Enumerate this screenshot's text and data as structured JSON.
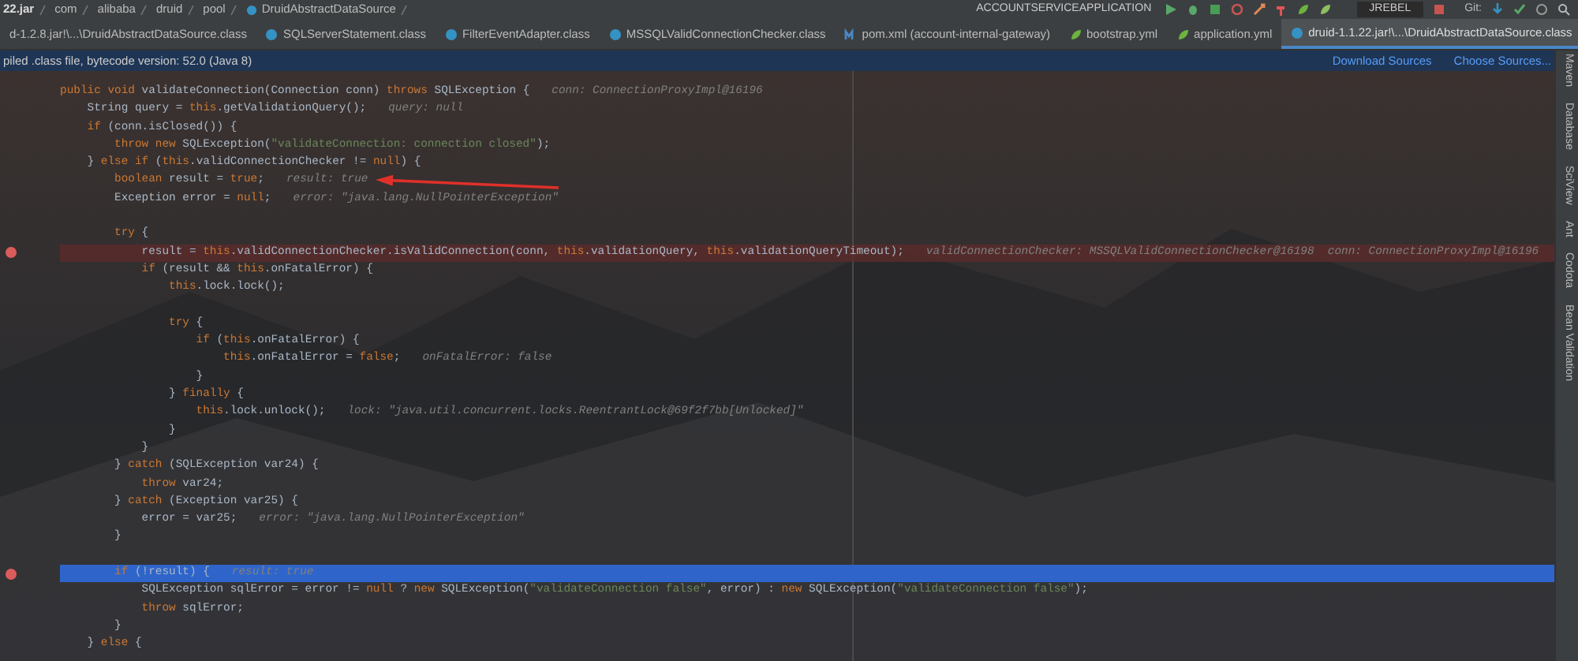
{
  "breadcrumbs": [
    "22.jar",
    "com",
    "alibaba",
    "druid",
    "pool",
    "DruidAbstractDataSource"
  ],
  "run_config": "ACCOUNTSERVICEAPPLICATION",
  "jrebel": "JREBEL",
  "vcs": "Git:",
  "tabs": [
    {
      "label": "d-1.2.8.jar!\\...\\DruidAbstractDataSource.class",
      "kind": "none",
      "selected": false
    },
    {
      "label": "SQLServerStatement.class",
      "kind": "class",
      "selected": false
    },
    {
      "label": "FilterEventAdapter.class",
      "kind": "class",
      "selected": false
    },
    {
      "label": "MSSQLValidConnectionChecker.class",
      "kind": "class",
      "selected": false
    },
    {
      "label": "pom.xml (account-internal-gateway)",
      "kind": "maven",
      "selected": false
    },
    {
      "label": "bootstrap.yml",
      "kind": "yaml",
      "selected": false
    },
    {
      "label": "application.yml",
      "kind": "yaml",
      "selected": false
    },
    {
      "label": "druid-1.1.22.jar!\\...\\DruidAbstractDataSource.class",
      "kind": "class",
      "selected": true
    }
  ],
  "info_bar": {
    "message": "piled .class file, bytecode version: 52.0 (Java 8)",
    "actions": [
      "Download Sources",
      "Choose Sources..."
    ]
  },
  "code": {
    "lines": [
      {
        "kind": "normal",
        "tokens": [
          {
            "kind": "kw",
            "text": "public void "
          },
          {
            "kind": "plain",
            "text": "validateConnection(Connection conn) "
          },
          {
            "kind": "kw",
            "text": "throws "
          },
          {
            "kind": "plain",
            "text": "SQLException {"
          }
        ],
        "hint": "conn: ConnectionProxyImpl@16196"
      },
      {
        "kind": "normal",
        "tokens": [
          {
            "kind": "plain",
            "text": "    String query = "
          },
          {
            "kind": "kw",
            "text": "this"
          },
          {
            "kind": "plain",
            "text": ".getValidationQuery();"
          }
        ],
        "hint": "query: null"
      },
      {
        "kind": "normal",
        "tokens": [
          {
            "kind": "kw",
            "text": "    if "
          },
          {
            "kind": "plain",
            "text": "(conn.isClosed()) {"
          }
        ]
      },
      {
        "kind": "normal",
        "tokens": [
          {
            "kind": "kw",
            "text": "        throw new "
          },
          {
            "kind": "plain",
            "text": "SQLException("
          },
          {
            "kind": "str",
            "text": "\"validateConnection: connection closed\""
          },
          {
            "kind": "plain",
            "text": ");"
          }
        ]
      },
      {
        "kind": "normal",
        "tokens": [
          {
            "kind": "plain",
            "text": "    } "
          },
          {
            "kind": "kw",
            "text": "else if "
          },
          {
            "kind": "plain",
            "text": "("
          },
          {
            "kind": "kw",
            "text": "this"
          },
          {
            "kind": "plain",
            "text": ".validConnectionChecker != "
          },
          {
            "kind": "kw",
            "text": "null"
          },
          {
            "kind": "plain",
            "text": ") {"
          }
        ]
      },
      {
        "kind": "normal",
        "tokens": [
          {
            "kind": "kw",
            "text": "        boolean "
          },
          {
            "kind": "plain",
            "text": "result = "
          },
          {
            "kind": "kw",
            "text": "true"
          },
          {
            "kind": "plain",
            "text": ";"
          }
        ],
        "hint": "result: true"
      },
      {
        "kind": "normal",
        "tokens": [
          {
            "kind": "plain",
            "text": "        Exception error = "
          },
          {
            "kind": "kw",
            "text": "null"
          },
          {
            "kind": "plain",
            "text": ";"
          }
        ],
        "hint": "error: \"java.lang.NullPointerException\""
      },
      {
        "kind": "blank"
      },
      {
        "kind": "normal",
        "tokens": [
          {
            "kind": "kw",
            "text": "        try "
          },
          {
            "kind": "plain",
            "text": "{"
          }
        ]
      },
      {
        "kind": "breakpoint",
        "tokens": [
          {
            "kind": "plain",
            "text": "            result = "
          },
          {
            "kind": "kw",
            "text": "this"
          },
          {
            "kind": "plain",
            "text": ".validConnectionChecker.isValidConnection(conn, "
          },
          {
            "kind": "kw",
            "text": "this"
          },
          {
            "kind": "plain",
            "text": ".validationQuery, "
          },
          {
            "kind": "kw",
            "text": "this"
          },
          {
            "kind": "plain",
            "text": ".validationQueryTimeout);"
          }
        ],
        "hint": "validConnectionChecker: MSSQLValidConnectionChecker@16198  conn: ConnectionProxyImpl@16196"
      },
      {
        "kind": "normal",
        "tokens": [
          {
            "kind": "kw",
            "text": "            if "
          },
          {
            "kind": "plain",
            "text": "(result && "
          },
          {
            "kind": "kw",
            "text": "this"
          },
          {
            "kind": "plain",
            "text": ".onFatalError) {"
          }
        ]
      },
      {
        "kind": "normal",
        "tokens": [
          {
            "kind": "kw",
            "text": "                this"
          },
          {
            "kind": "plain",
            "text": ".lock.lock();"
          }
        ]
      },
      {
        "kind": "blank"
      },
      {
        "kind": "normal",
        "tokens": [
          {
            "kind": "kw",
            "text": "                try "
          },
          {
            "kind": "plain",
            "text": "{"
          }
        ]
      },
      {
        "kind": "normal",
        "tokens": [
          {
            "kind": "kw",
            "text": "                    if "
          },
          {
            "kind": "plain",
            "text": "("
          },
          {
            "kind": "kw",
            "text": "this"
          },
          {
            "kind": "plain",
            "text": ".onFatalError) {"
          }
        ]
      },
      {
        "kind": "normal",
        "tokens": [
          {
            "kind": "kw",
            "text": "                        this"
          },
          {
            "kind": "plain",
            "text": ".onFatalError = "
          },
          {
            "kind": "kw",
            "text": "false"
          },
          {
            "kind": "plain",
            "text": ";"
          }
        ],
        "hint": "onFatalError: false"
      },
      {
        "kind": "normal",
        "tokens": [
          {
            "kind": "plain",
            "text": "                    }"
          }
        ]
      },
      {
        "kind": "normal",
        "tokens": [
          {
            "kind": "plain",
            "text": "                } "
          },
          {
            "kind": "kw",
            "text": "finally "
          },
          {
            "kind": "plain",
            "text": "{"
          }
        ]
      },
      {
        "kind": "normal",
        "tokens": [
          {
            "kind": "kw",
            "text": "                    this"
          },
          {
            "kind": "plain",
            "text": ".lock.unlock();"
          }
        ],
        "hint": "lock: \"java.util.concurrent.locks.ReentrantLock@69f2f7bb[Unlocked]\""
      },
      {
        "kind": "normal",
        "tokens": [
          {
            "kind": "plain",
            "text": "                }"
          }
        ]
      },
      {
        "kind": "normal",
        "tokens": [
          {
            "kind": "plain",
            "text": "            }"
          }
        ]
      },
      {
        "kind": "normal",
        "tokens": [
          {
            "kind": "plain",
            "text": "        } "
          },
          {
            "kind": "kw",
            "text": "catch "
          },
          {
            "kind": "plain",
            "text": "(SQLException var24) {"
          }
        ]
      },
      {
        "kind": "normal",
        "tokens": [
          {
            "kind": "kw",
            "text": "            throw "
          },
          {
            "kind": "plain",
            "text": "var24;"
          }
        ]
      },
      {
        "kind": "normal",
        "tokens": [
          {
            "kind": "plain",
            "text": "        } "
          },
          {
            "kind": "kw",
            "text": "catch "
          },
          {
            "kind": "plain",
            "text": "(Exception var25) {"
          }
        ]
      },
      {
        "kind": "normal",
        "tokens": [
          {
            "kind": "plain",
            "text": "            error = var25;"
          }
        ],
        "hint": "error: \"java.lang.NullPointerException\""
      },
      {
        "kind": "normal",
        "tokens": [
          {
            "kind": "plain",
            "text": "        }"
          }
        ]
      },
      {
        "kind": "blank"
      },
      {
        "kind": "current",
        "tokens": [
          {
            "kind": "kw",
            "text": "        if "
          },
          {
            "kind": "plain",
            "text": "(!result) {"
          }
        ],
        "hint": "result: true"
      },
      {
        "kind": "normal",
        "tokens": [
          {
            "kind": "plain",
            "text": "            SQLException sqlError = error != "
          },
          {
            "kind": "kw",
            "text": "null "
          },
          {
            "kind": "plain",
            "text": "? "
          },
          {
            "kind": "kw",
            "text": "new "
          },
          {
            "kind": "plain",
            "text": "SQLException("
          },
          {
            "kind": "str",
            "text": "\"validateConnection false\""
          },
          {
            "kind": "plain",
            "text": ", error) : "
          },
          {
            "kind": "kw",
            "text": "new "
          },
          {
            "kind": "plain",
            "text": "SQLException("
          },
          {
            "kind": "str",
            "text": "\"validateConnection false\""
          },
          {
            "kind": "plain",
            "text": ");"
          }
        ]
      },
      {
        "kind": "normal",
        "tokens": [
          {
            "kind": "kw",
            "text": "            throw "
          },
          {
            "kind": "plain",
            "text": "sqlError;"
          }
        ]
      },
      {
        "kind": "normal",
        "tokens": [
          {
            "kind": "plain",
            "text": "        }"
          }
        ]
      },
      {
        "kind": "normal",
        "tokens": [
          {
            "kind": "plain",
            "text": "    } "
          },
          {
            "kind": "kw",
            "text": "else "
          },
          {
            "kind": "plain",
            "text": "{"
          }
        ]
      }
    ]
  },
  "side_tools": [
    "Maven",
    "Database",
    "SciView",
    "Ant",
    "Codota",
    "Bean Validation"
  ]
}
